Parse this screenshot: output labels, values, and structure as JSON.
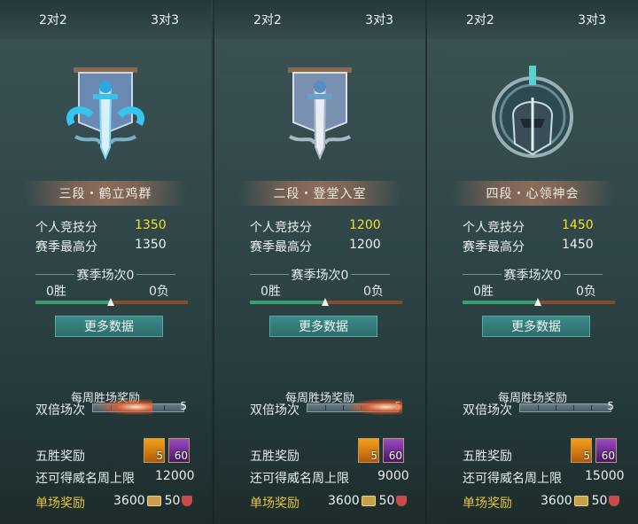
{
  "panels": [
    {
      "tab_2v2": "2对2",
      "tab_3v3": "3对3",
      "emblem": "banner-sword-cyan-icon",
      "rank": "三段・鹤立鸡群",
      "score_label": "个人竞技分",
      "score": "1350",
      "best_label": "赛季最高分",
      "best": "1350",
      "season": "赛季场次0",
      "wins": "0胜",
      "losses": "0负",
      "more_btn": "更多数据",
      "weekly": "每周胜场奖励",
      "double_label": "双倍场次",
      "double_count": "5",
      "five_win": "五胜奖励",
      "item1_count": "5",
      "item2_count": "60",
      "prestige_label": "还可得威名周上限",
      "prestige": "12000",
      "single_label": "单场奖励",
      "coins": "3600",
      "medals": "50"
    },
    {
      "tab_2v2": "2对2",
      "tab_3v3": "3对3",
      "emblem": "banner-sword-silver-icon",
      "rank": "二段・登堂入室",
      "score_label": "个人竞技分",
      "score": "1200",
      "best_label": "赛季最高分",
      "best": "1200",
      "season": "赛季场次0",
      "wins": "0胜",
      "losses": "0负",
      "more_btn": "更多数据",
      "weekly": "每周胜场奖励",
      "double_label": "双倍场次",
      "double_count": "5",
      "five_win": "五胜奖励",
      "item1_count": "5",
      "item2_count": "60",
      "prestige_label": "还可得威名周上限",
      "prestige": "9000",
      "single_label": "单场奖励",
      "coins": "3600",
      "medals": "50"
    },
    {
      "tab_2v2": "2对2",
      "tab_3v3": "3对3",
      "emblem": "helmet-ring-icon",
      "rank": "四段・心领神会",
      "score_label": "个人竞技分",
      "score": "1450",
      "best_label": "赛季最高分",
      "best": "1450",
      "season": "赛季场次0",
      "wins": "0胜",
      "losses": "0负",
      "more_btn": "更多数据",
      "weekly": "每周胜场奖励",
      "double_label": "双倍场次",
      "double_count": "5",
      "five_win": "五胜奖励",
      "item1_count": "5",
      "item2_count": "60",
      "prestige_label": "还可得威名周上限",
      "prestige": "15000",
      "single_label": "单场奖励",
      "coins": "3600",
      "medals": "50"
    }
  ],
  "colors": {
    "accent_gold": "#f2e22a",
    "button_teal": "#2c6e6c",
    "win_green": "#3aa06a",
    "loss_orange": "#8a4a28"
  }
}
